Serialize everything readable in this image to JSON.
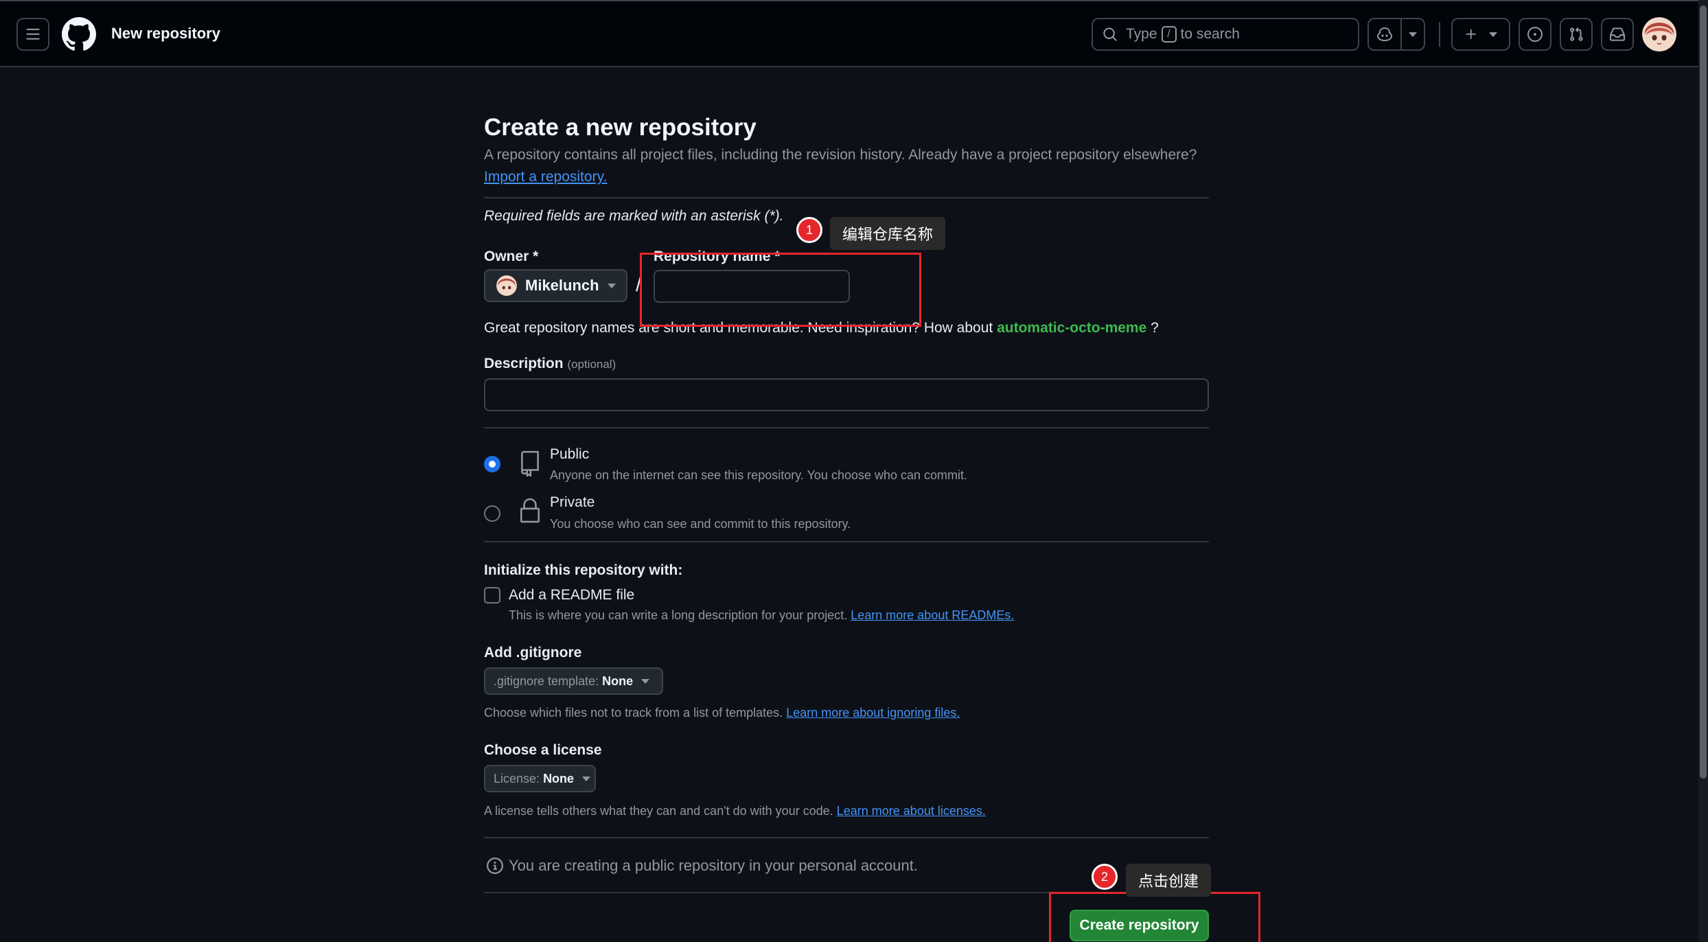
{
  "header": {
    "page_title": "New repository",
    "search_prefix": "Type",
    "search_key": "/",
    "search_suffix": "to search"
  },
  "main": {
    "heading": "Create a new repository",
    "intro": "A repository contains all project files, including the revision history. Already have a project repository elsewhere?",
    "import_link": "Import a repository.",
    "required_note": "Required fields are marked with an asterisk (*).",
    "owner_label": "Owner *",
    "owner_value": "Mikelunch",
    "slash": "/",
    "repo_name_label": "Repository name *",
    "repo_name_value": "",
    "great_names_text": "Great repository names are short and memorable. Need inspiration? How about",
    "suggested_name": "automatic-octo-meme",
    "great_names_end": " ?",
    "description_label": "Description",
    "description_optional": "(optional)",
    "description_value": "",
    "visibility": {
      "public_title": "Public",
      "public_desc": "Anyone on the internet can see this repository. You choose who can commit.",
      "private_title": "Private",
      "private_desc": "You choose who can see and commit to this repository.",
      "selected": "public"
    },
    "init_label": "Initialize this repository with:",
    "readme_label": "Add a README file",
    "readme_desc": "This is where you can write a long description for your project.",
    "readme_link": "Learn more about READMEs.",
    "gitignore_label": "Add .gitignore",
    "gitignore_prefix": ".gitignore template:",
    "gitignore_value": "None",
    "gitignore_desc": "Choose which files not to track from a list of templates.",
    "gitignore_link": "Learn more about ignoring files.",
    "license_label": "Choose a license",
    "license_prefix": "License:",
    "license_value": "None",
    "license_desc": "A license tells others what they can and can't do with your code.",
    "license_link": "Learn more about licenses.",
    "notice": "You are creating a public repository in your personal account.",
    "create_button": "Create repository"
  },
  "annotations": {
    "step1_number": "1",
    "step1_text": "编辑仓库名称",
    "step2_number": "2",
    "step2_text": "点击创建",
    "color": "#e5262b"
  },
  "colors": {
    "background": "#0d1117",
    "header": "#010409",
    "accent_link": "#4493f8",
    "primary_button": "#238636",
    "suggest_green": "#3fb950"
  }
}
